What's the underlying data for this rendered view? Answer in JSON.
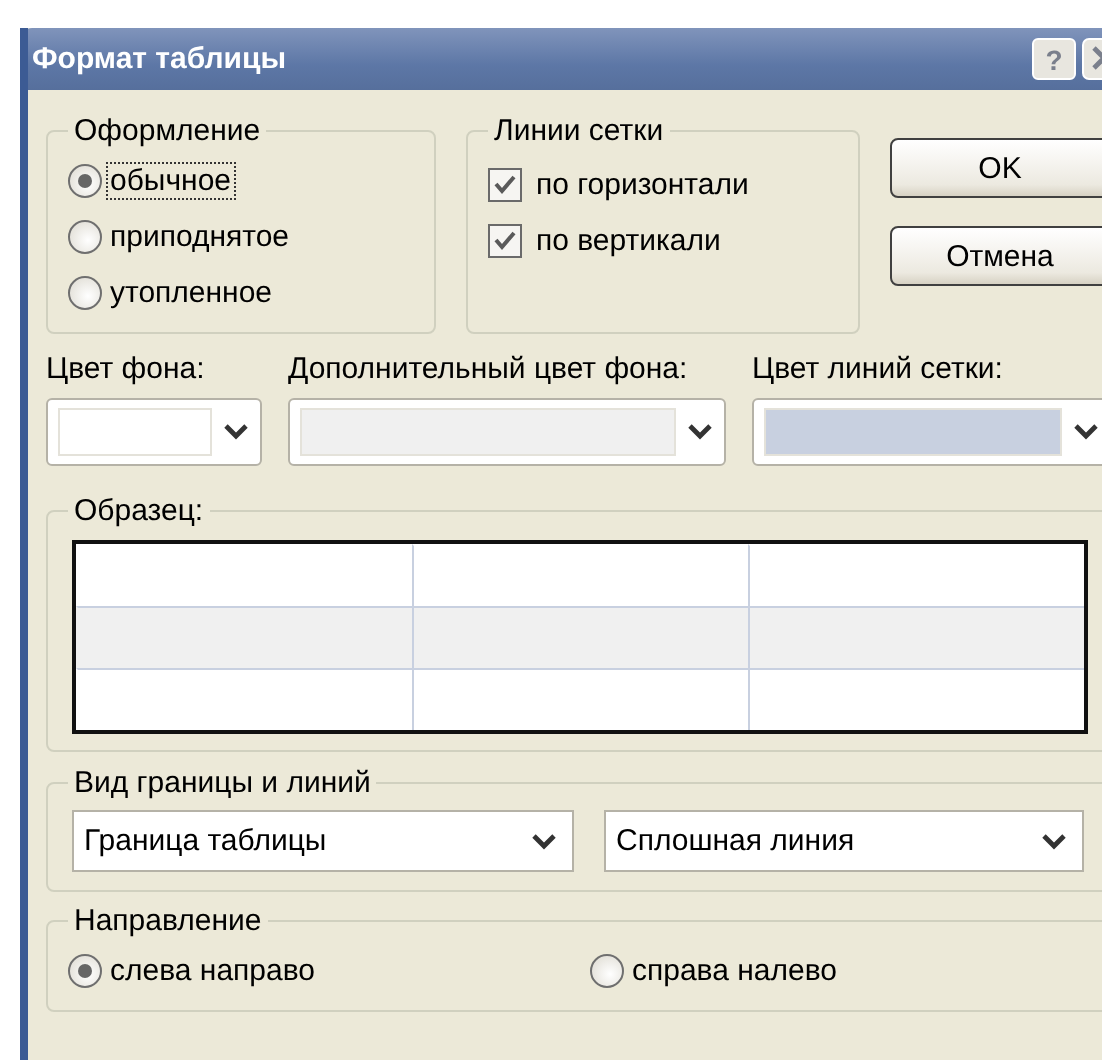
{
  "window": {
    "title": "Формат таблицы",
    "help_button": "?"
  },
  "style_group": {
    "title": "Оформление",
    "options": [
      {
        "label": "обычное",
        "selected": true
      },
      {
        "label": "приподнятое",
        "selected": false
      },
      {
        "label": "утопленное",
        "selected": false
      }
    ]
  },
  "gridlines_group": {
    "title": "Линии сетки",
    "options": [
      {
        "label": "по горизонтали",
        "checked": true
      },
      {
        "label": "по вертикали",
        "checked": true
      }
    ]
  },
  "buttons": [
    "OK",
    "Отмена"
  ],
  "color_pickers": [
    {
      "label": "Цвет фона:",
      "color": "#ffffff"
    },
    {
      "label": "Дополнительный цвет фона:",
      "color": "#f0f0f0"
    },
    {
      "label": "Цвет линий сетки:",
      "color": "#c8d0e0"
    }
  ],
  "sample": {
    "title": "Образец:"
  },
  "border_group": {
    "title": "Вид границы и линий",
    "dropdowns": [
      "Граница таблицы",
      "Сплошная линия"
    ]
  },
  "direction_group": {
    "title": "Направление",
    "options": [
      {
        "label": "слева направо",
        "selected": true
      },
      {
        "label": "справа налево",
        "selected": false
      }
    ]
  }
}
